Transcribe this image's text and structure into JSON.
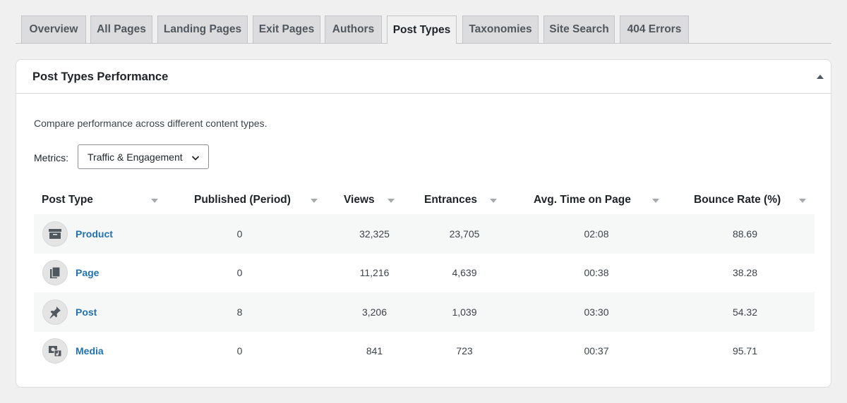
{
  "tabs": [
    {
      "label": "Overview"
    },
    {
      "label": "All Pages"
    },
    {
      "label": "Landing Pages"
    },
    {
      "label": "Exit Pages"
    },
    {
      "label": "Authors"
    },
    {
      "label": "Post Types"
    },
    {
      "label": "Taxonomies"
    },
    {
      "label": "Site Search"
    },
    {
      "label": "404 Errors"
    }
  ],
  "active_tab": "Post Types",
  "panel": {
    "title": "Post Types Performance",
    "description": "Compare performance across different content types.",
    "metrics_label": "Metrics:",
    "metrics_value": "Traffic & Engagement"
  },
  "table": {
    "headers": [
      "Post Type",
      "Published (Period)",
      "Views",
      "Entrances",
      "Avg. Time on Page",
      "Bounce Rate (%)"
    ],
    "rows": [
      {
        "icon": "archive-box-icon",
        "type": "Product",
        "published": "0",
        "views": "32,325",
        "entrances": "23,705",
        "avg_time": "02:08",
        "bounce": "88.69"
      },
      {
        "icon": "page-copy-icon",
        "type": "Page",
        "published": "0",
        "views": "11,216",
        "entrances": "4,639",
        "avg_time": "00:38",
        "bounce": "38.28"
      },
      {
        "icon": "pushpin-icon",
        "type": "Post",
        "published": "8",
        "views": "3,206",
        "entrances": "1,039",
        "avg_time": "03:30",
        "bounce": "54.32"
      },
      {
        "icon": "media-icon",
        "type": "Media",
        "published": "0",
        "views": "841",
        "entrances": "723",
        "avg_time": "00:37",
        "bounce": "95.71"
      }
    ]
  },
  "colors": {
    "link": "#2271b1",
    "background": "#f0f0f1",
    "tab_inactive": "#dcdcde",
    "row_alt": "#f6f7f7"
  }
}
